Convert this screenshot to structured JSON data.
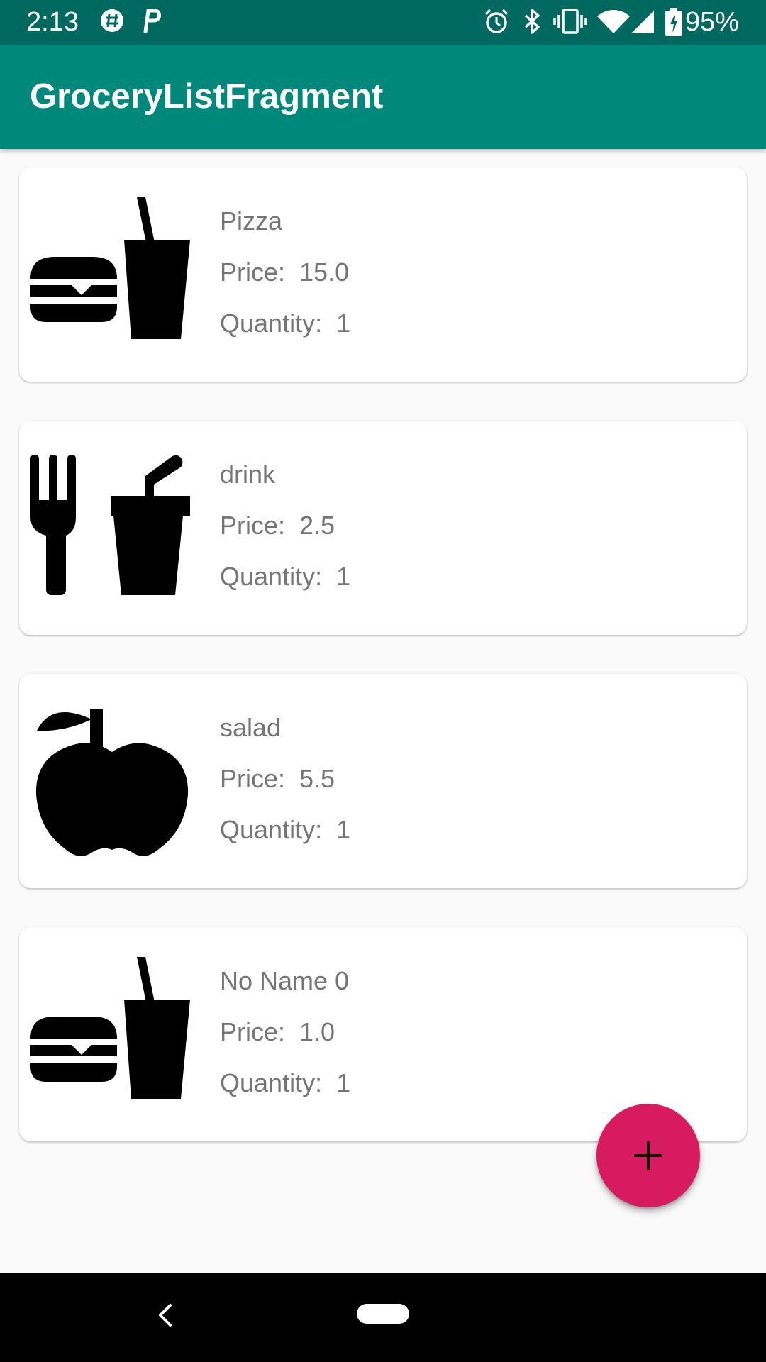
{
  "status_bar": {
    "time": "2:13",
    "battery": "95%",
    "icons": [
      "slack-icon",
      "p-icon",
      "alarm-icon",
      "bluetooth-icon",
      "vibrate-icon",
      "wifi-icon",
      "signal-icon",
      "battery-icon"
    ]
  },
  "app_bar": {
    "title": "GroceryListFragment"
  },
  "items": [
    {
      "icon": "fastfood-icon",
      "name": "Pizza",
      "price": "Price:  15.0",
      "quantity": "Quantity:  1"
    },
    {
      "icon": "local-drink-icon",
      "name": "drink",
      "price": "Price:  2.5",
      "quantity": "Quantity:  1"
    },
    {
      "icon": "apple-icon",
      "name": "salad",
      "price": "Price:  5.5",
      "quantity": "Quantity:  1"
    },
    {
      "icon": "fastfood-icon",
      "name": "No Name 0",
      "price": "Price:  1.0",
      "quantity": "Quantity:  1"
    }
  ],
  "fab": {
    "icon": "add-icon"
  },
  "nav_bar": {
    "back_icon": "back-icon",
    "home_icon": "home-pill-icon"
  },
  "colors": {
    "primary": "#00897b",
    "primary_dark": "#00695f",
    "accent": "#d81b60",
    "text_secondary": "#757575"
  }
}
